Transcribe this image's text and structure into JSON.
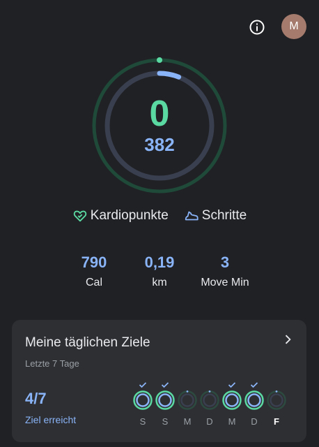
{
  "header": {
    "avatar_initial": "M",
    "info_icon": "info-icon"
  },
  "ring": {
    "heart_points": "0",
    "steps": "382",
    "heart_progress": 0.0,
    "steps_progress": 0.06,
    "colors": {
      "heart": "#5bd9a3",
      "steps": "#8ab4f8"
    }
  },
  "legend": {
    "heart_label": "Kardiopunkte",
    "steps_label": "Schritte"
  },
  "stats": {
    "cal_value": "790",
    "cal_label": "Cal",
    "km_value": "0,19",
    "km_label": "km",
    "move_value": "3",
    "move_label": "Move Min"
  },
  "goals_card": {
    "title": "Meine täglichen Ziele",
    "subtitle": "Letzte 7 Tage",
    "achieved": "4/7",
    "achieved_label": "Ziel erreicht",
    "days": [
      {
        "label": "S",
        "met": true,
        "today": false
      },
      {
        "label": "S",
        "met": true,
        "today": false
      },
      {
        "label": "M",
        "met": false,
        "today": false
      },
      {
        "label": "D",
        "met": false,
        "today": false
      },
      {
        "label": "M",
        "met": true,
        "today": false
      },
      {
        "label": "D",
        "met": true,
        "today": false
      },
      {
        "label": "F",
        "met": false,
        "today": true
      }
    ]
  }
}
